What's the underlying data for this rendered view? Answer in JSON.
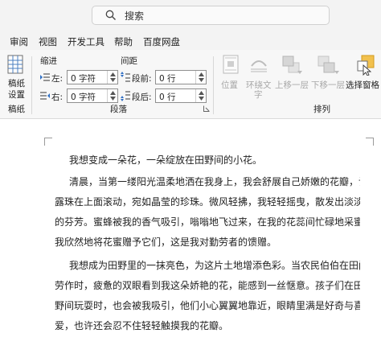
{
  "search": {
    "label": "搜索"
  },
  "menu": [
    "审阅",
    "视图",
    "开发工具",
    "帮助",
    "百度网盘"
  ],
  "ribbon": {
    "manuscript": {
      "label_line1": "稿纸",
      "label_line2": "设置",
      "group": "稿纸"
    },
    "paragraph": {
      "group": "段落",
      "indent_title": "缩进",
      "spacing_title": "间距",
      "left_label": "左:",
      "left_value": "0 字符",
      "right_label": "右:",
      "right_value": "0 字符",
      "before_label": "段前:",
      "before_value": "0 行",
      "after_label": "段后:",
      "after_value": "0 行"
    },
    "arrange": {
      "group": "排列",
      "position": "位置",
      "wrap_line1": "环绕文",
      "wrap_line2": "字",
      "bring_forward": "上移一层",
      "send_backward": "下移一层",
      "selection_pane": "选择窗格"
    }
  },
  "document": {
    "paragraphs": [
      [
        "我想变成一朵花，一朵绽放在田野间的小花。"
      ],
      [
        "清晨，当第一缕阳光温柔地洒在我身上，我会舒展自己娇嫩的花瓣，让",
        "露珠在上面滚动，宛如晶莹的珍珠。微风轻拂，我轻轻摇曳，散发出淡淡",
        "的芬芳。蜜蜂被我的香气吸引，嗡嗡地飞过来，在我的花蕊间忙碌地采蜜，",
        "我欣然地将花蜜赠予它们，这是我对勤劳者的馈赠。"
      ],
      [
        "我想成为田野里的一抹亮色，为这片土地增添色彩。当农民伯伯在田间",
        "劳作时，疲惫的双眼看到我这朵娇艳的花，能感到一丝惬意。孩子们在田",
        "野间玩耍时，也会被我吸引，他们小心翼翼地靠近，眼睛里满是好奇与喜",
        "爱，也许还会忍不住轻轻触摸我的花瓣。"
      ]
    ]
  }
}
